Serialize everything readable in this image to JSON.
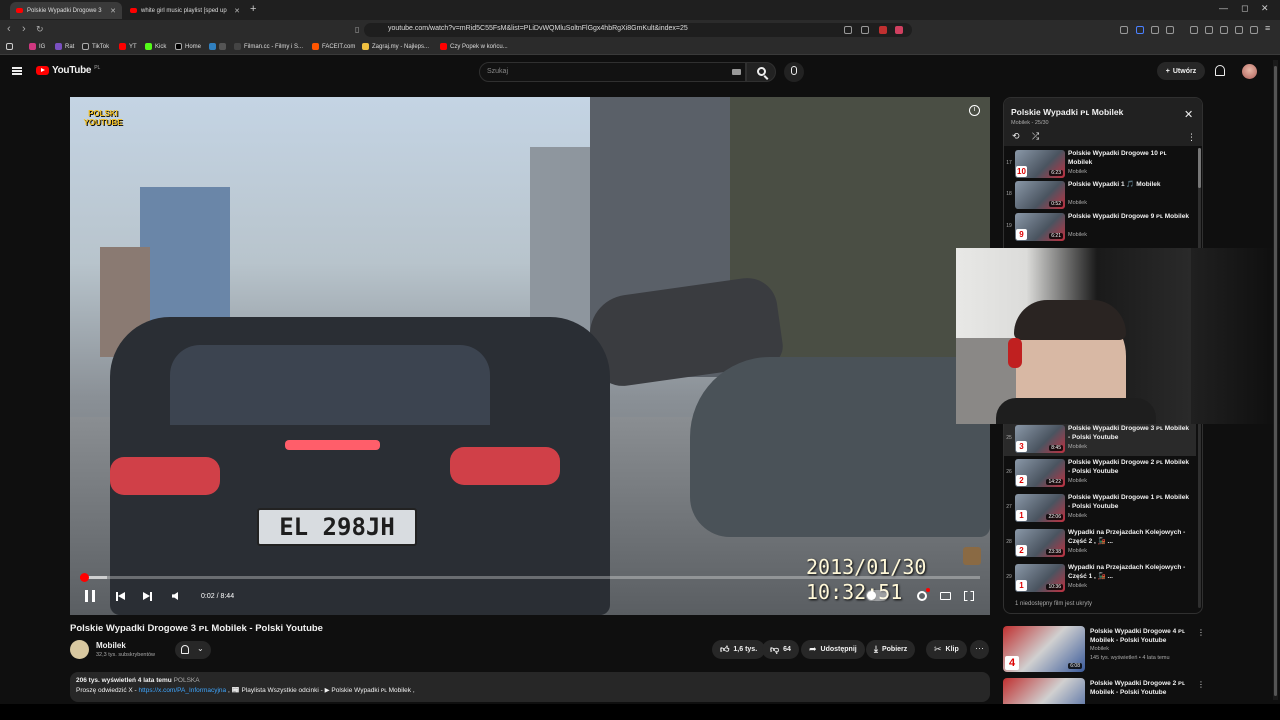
{
  "browser": {
    "tabs": [
      {
        "title": "Polskie Wypadki Drogowe 3"
      },
      {
        "title": "white girl music playlist [sped up"
      }
    ],
    "url": "youtube.com/watch?v=mRid5C55FsM&list=PLiDvWQMluSoltnFlGgx4hbRgXi8GmKult&index=25",
    "bookmarks": [
      "IG",
      "Rat",
      "TikTok",
      "YT",
      "Kick",
      "Home",
      "",
      "Filman.cc - Filmy i S...",
      "FACEIT.com",
      "Zagraj.my - Najleps...",
      "Czy Popek w końcu..."
    ]
  },
  "header": {
    "logo_text": "YouTube",
    "logo_region": "PL",
    "search_placeholder": "Szukaj",
    "create_label": "Utwórz"
  },
  "player": {
    "watermark": "POLSKI YOUTUBE",
    "plate": "EL 298JH",
    "timestamp_date": "2013/01/30",
    "timestamp_time": "10:32:51",
    "time_display": "0:02 / 8:44",
    "progress_fraction": 0.004,
    "buffer_fraction": 0.03
  },
  "video": {
    "title": "Polskie Wypadki Drogowe 3 ᴘʟ Mobilek - Polski Youtube",
    "channel": "Mobilek",
    "subscribers": "32,3 tys. subskrybentów",
    "likes": "1,6 tys.",
    "dislikes": "64",
    "share_label": "Udostępnij",
    "download_label": "Pobierz",
    "clip_label": "Klip",
    "more_label": "···",
    "desc_stats": "206 tys. wyświetleń  4 lata temu",
    "desc_location": "POLSKA",
    "desc_prefix": "Proszę odwiedzić X - ",
    "desc_link": "https://x.com/PA_Informacyjna",
    "desc_middle": " , 📰 Playlista Wszystkie odcinki - ",
    "desc_playlist": "▶ Polskie Wypadki ᴘʟ Mobilek",
    "desc_end": " ,"
  },
  "playlist": {
    "title": "Polskie Wypadki ᴘʟ Mobilek",
    "subtitle": "Mobilek - 25/30",
    "unavailable": "1 niedostępny film jest ukryty",
    "items": [
      {
        "num": "17",
        "title": "Polskie Wypadki Drogowe 10 ᴘʟ Mobilek",
        "channel": "Mobilek",
        "duration": "6:23",
        "badge": "10"
      },
      {
        "num": "18",
        "title": "Polskie Wypadki 1 🎵 Mobilek",
        "channel": "Mobilek",
        "duration": "0:52",
        "badge": ""
      },
      {
        "num": "19",
        "title": "Polskie Wypadki Drogowe 9 ᴘʟ Mobilek",
        "channel": "Mobilek",
        "duration": "6:21",
        "badge": "9"
      },
      {
        "num": "25",
        "title": "Polskie Wypadki Drogowe 3 ᴘʟ Mobilek - Polski Youtube",
        "channel": "Mobilek",
        "duration": "8:45",
        "badge": "3"
      },
      {
        "num": "26",
        "title": "Polskie Wypadki Drogowe 2 ᴘʟ Mobilek - Polski Youtube",
        "channel": "Mobilek",
        "duration": "14:22",
        "badge": "2"
      },
      {
        "num": "27",
        "title": "Polskie Wypadki Drogowe 1 ᴘʟ Mobilek - Polski Youtube",
        "channel": "Mobilek",
        "duration": "22:06",
        "badge": "1"
      },
      {
        "num": "28",
        "title": "Wypadki na Przejazdach Kolejowych - Część 2 , 🚂 ...",
        "channel": "Mobilek",
        "duration": "23:38",
        "badge": "2"
      },
      {
        "num": "29",
        "title": "Wypadki na Przejazdach Kolejowych - Część 1 , 🚂 ...",
        "channel": "Mobilek",
        "duration": "10:36",
        "badge": "1"
      }
    ]
  },
  "recommended": [
    {
      "title": "Polskie Wypadki Drogowe  4 ᴘʟ Mobilek - Polski Youtube",
      "channel": "Mobilek",
      "views": "145 tys. wyświetleń • 4 lata temu",
      "duration": "6:08",
      "badge": "4"
    },
    {
      "title": "Polskie Wypadki Drogowe  2 ᴘʟ Mobilek - Polski Youtube",
      "channel": "",
      "views": "",
      "duration": "",
      "badge": "2"
    }
  ]
}
